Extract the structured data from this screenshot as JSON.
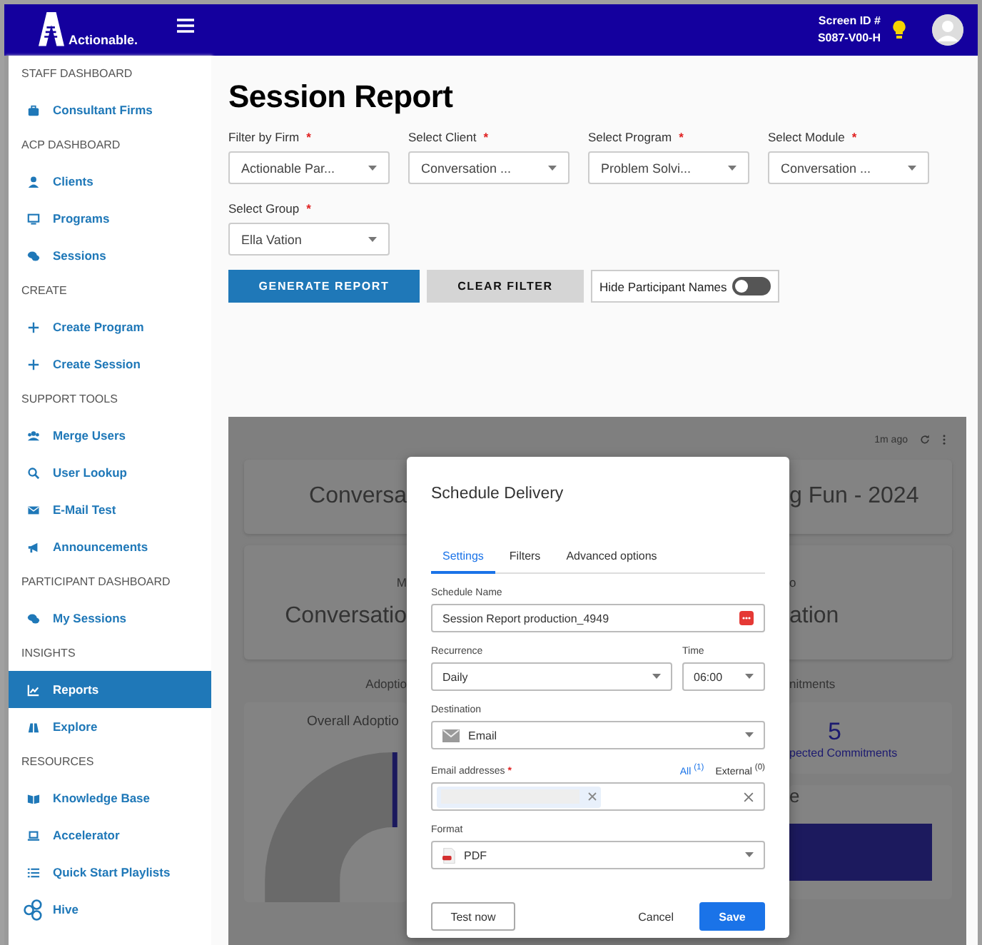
{
  "header": {
    "logo_text": "Actionable.",
    "screen_id_label": "Screen ID #",
    "screen_id": "S087-V00-H"
  },
  "sidebar": {
    "sections": [
      {
        "title": "STAFF DASHBOARD",
        "items": [
          {
            "label": "Consultant Firms",
            "selected": false
          }
        ]
      },
      {
        "title": "ACP DASHBOARD",
        "items": [
          {
            "label": "Clients",
            "selected": false
          },
          {
            "label": "Programs",
            "selected": false
          },
          {
            "label": "Sessions",
            "selected": false
          }
        ]
      },
      {
        "title": "CREATE",
        "items": [
          {
            "label": "Create Program",
            "selected": false
          },
          {
            "label": "Create Session",
            "selected": false
          }
        ]
      },
      {
        "title": "SUPPORT TOOLS",
        "items": [
          {
            "label": "Merge Users",
            "selected": false
          },
          {
            "label": "User Lookup",
            "selected": false
          },
          {
            "label": "E-Mail Test",
            "selected": false
          },
          {
            "label": "Announcements",
            "selected": false
          }
        ]
      },
      {
        "title": "PARTICIPANT DASHBOARD",
        "items": [
          {
            "label": "My Sessions",
            "selected": false
          }
        ]
      },
      {
        "title": "INSIGHTS",
        "items": [
          {
            "label": "Reports",
            "selected": true
          },
          {
            "label": "Explore",
            "selected": false
          }
        ]
      },
      {
        "title": "RESOURCES",
        "items": [
          {
            "label": "Knowledge Base",
            "selected": false
          },
          {
            "label": "Accelerator",
            "selected": false
          },
          {
            "label": "Quick Start Playlists",
            "selected": false
          },
          {
            "label": "Hive",
            "selected": false
          }
        ]
      }
    ]
  },
  "page": {
    "title": "Session Report",
    "filters": [
      {
        "label": "Filter by Firm",
        "mark": "*",
        "value": "Actionable Par..."
      },
      {
        "label": "Select Client",
        "mark": "*",
        "value": "Conversation ..."
      },
      {
        "label": "Select Program",
        "mark": "*",
        "value": "Problem Solvi..."
      },
      {
        "label": "Select Module",
        "mark": "*",
        "value": "Conversation ..."
      },
      {
        "label": "Select Group",
        "mark": "*",
        "value": "Ella Vation"
      }
    ],
    "generate_button": "GENERATE REPORT",
    "clear_button": "CLEAR FILTER",
    "toggle": {
      "label": "Hide Participant Names",
      "on": false
    }
  },
  "dashboard": {
    "updated": "1m ago",
    "title_left": "Conversa",
    "title_right": "g Fun - 2024",
    "metric_label_left": "M",
    "metric_label_right": "o",
    "metric_left": "Conversatio",
    "metric_right": "ation",
    "section_left": "Adoptio",
    "section_right": "nitments",
    "chart_title": "Overall Adoptio",
    "count": "5",
    "count_label": "pected Commitments",
    "panel_title": "e"
  },
  "dialog": {
    "title": "Schedule Delivery",
    "tabs": [
      {
        "label": "Settings",
        "selected": true
      },
      {
        "label": "Filters",
        "selected": false
      },
      {
        "label": "Advanced options",
        "selected": false
      }
    ],
    "schedule_name": {
      "label": "Schedule Name",
      "value": "Session Report production_4949"
    },
    "recurrence": {
      "label": "Recurrence",
      "value": "Daily"
    },
    "time": {
      "label": "Time",
      "value": "06:00"
    },
    "destination": {
      "label": "Destination",
      "value": "Email"
    },
    "emails": {
      "label": "Email addresses",
      "mark": "*",
      "filters": [
        {
          "label": "All",
          "count": "(1)",
          "selected": true
        },
        {
          "label": "External",
          "count": "(0)",
          "selected": false
        }
      ]
    },
    "format": {
      "label": "Format",
      "value": "PDF"
    },
    "buttons": {
      "test": "Test now",
      "cancel": "Cancel",
      "save": "Save"
    }
  }
}
